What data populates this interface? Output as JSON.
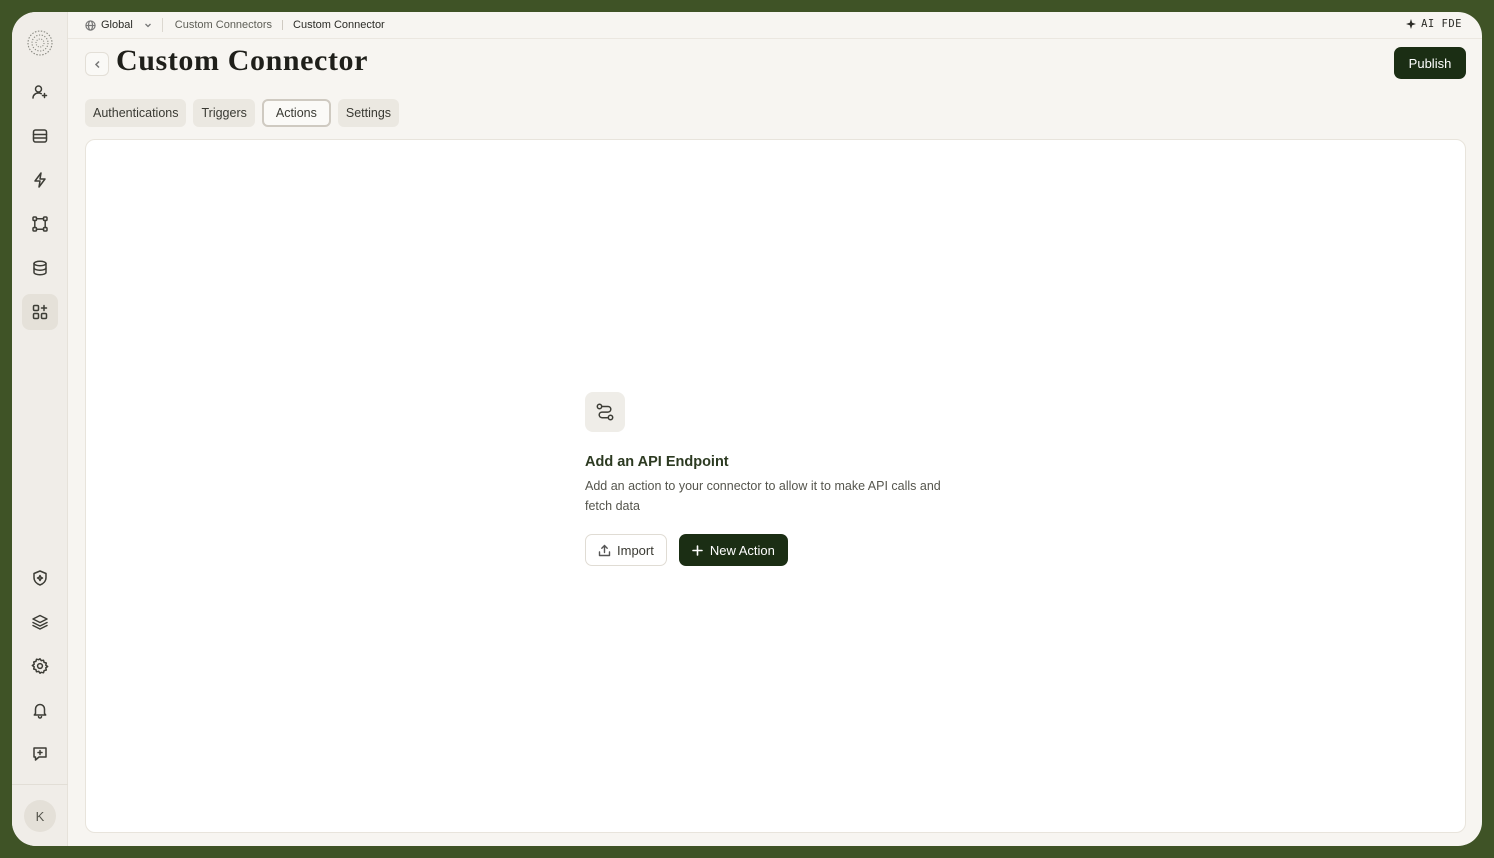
{
  "topbar": {
    "scope": "Global",
    "breadcrumbs": [
      "Custom Connectors",
      "Custom Connector"
    ],
    "ai_label": "AI FDE"
  },
  "header": {
    "title": "Custom Connector",
    "publish_label": "Publish"
  },
  "tabs": [
    {
      "label": "Authentications",
      "active": false
    },
    {
      "label": "Triggers",
      "active": false
    },
    {
      "label": "Actions",
      "active": true
    },
    {
      "label": "Settings",
      "active": false
    }
  ],
  "sidebar": {
    "icons": [
      "user-sparkle-icon",
      "panel-icon",
      "bolt-icon",
      "workflow-icon",
      "database-icon",
      "apps-icon",
      "shield-sparkle-icon",
      "layers-icon",
      "gear-icon",
      "bell-icon",
      "feedback-icon"
    ],
    "active": "apps-icon",
    "avatar_initial": "K"
  },
  "empty_state": {
    "icon": "route-icon",
    "title": "Add an API Endpoint",
    "description": "Add an action to your connector to allow it to make API calls and fetch data",
    "import_label": "Import",
    "new_action_label": "New Action"
  },
  "colors": {
    "primary": "#1b2e14",
    "frame": "#3f5326",
    "background": "#f7f5f1"
  }
}
